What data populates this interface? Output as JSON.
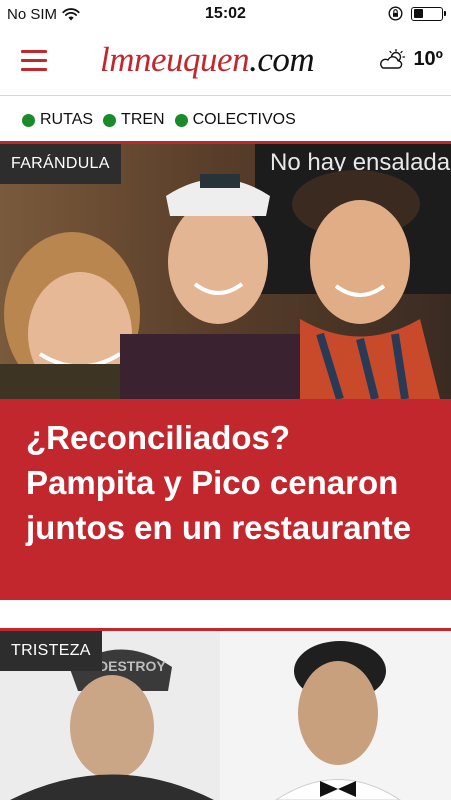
{
  "status_bar": {
    "carrier": "No SIM",
    "time": "15:02"
  },
  "header": {
    "logo_brand": "lmneuquen",
    "logo_tld": ".com",
    "weather_icon": "partly-cloudy-icon",
    "temperature": "10º"
  },
  "transit": {
    "links": [
      "RUTAS",
      "TREN",
      "COLECTIVOS"
    ],
    "dot_color": "#1a8a2a"
  },
  "articles": [
    {
      "category": "FARÁNDULA",
      "title": "¿Reconciliados? Pampita y Pico cenaron juntos en un restaurante",
      "photo_caption": "No hay ensalada"
    },
    {
      "category": "TRISTEZA",
      "photo_caption": "DESTROY"
    }
  ],
  "colors": {
    "accent": "#c1272d",
    "tag_bg": "#2d2d2d"
  }
}
